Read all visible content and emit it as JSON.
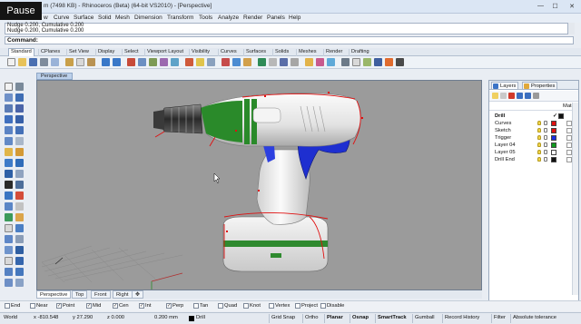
{
  "window": {
    "title": "m (7498 KB) - Rhinoceros (Beta) (64-bit VS2010) - [Perspective]",
    "pause_label": "Pause",
    "min": "—",
    "max": "☐",
    "close": "✕"
  },
  "menu": [
    "Curve",
    "Surface",
    "Solid",
    "Mesh",
    "Dimension",
    "Transform",
    "Tools",
    "Analyze",
    "Render",
    "Panels",
    "Help"
  ],
  "menu_partial": "w",
  "history": [
    "Nudge 0.200, Cumulative 0.200",
    "Nudge 0.200, Cumulative 0.200"
  ],
  "command": {
    "label": "Command:",
    "value": ""
  },
  "toolbar_tabs": [
    "Standard",
    "CPlanes",
    "Set View",
    "Display",
    "Select",
    "Viewport Layout",
    "Visibility",
    "Curves",
    "Surfaces",
    "Solids",
    "Meshes",
    "Render",
    "Drafting"
  ],
  "viewport": {
    "title": "Perspective",
    "tabs": [
      "Perspective",
      "Top",
      "Front",
      "Right"
    ],
    "add_tab": "✥"
  },
  "osnap": [
    {
      "label": "End",
      "checked": false
    },
    {
      "label": "Near",
      "checked": false
    },
    {
      "label": "Point",
      "checked": true
    },
    {
      "label": "Mid",
      "checked": true
    },
    {
      "label": "Cen",
      "checked": true
    },
    {
      "label": "Int",
      "checked": true
    },
    {
      "label": "Perp",
      "checked": true
    },
    {
      "label": "Tan",
      "checked": false
    },
    {
      "label": "Quad",
      "checked": false
    },
    {
      "label": "Knot",
      "checked": false
    },
    {
      "label": "Vertex",
      "checked": false
    },
    {
      "label": "Project",
      "checked": false
    },
    {
      "label": "Disable",
      "checked": false
    }
  ],
  "status": {
    "cplane": "World",
    "x": "x -810.548",
    "y": "y 27.290",
    "z": "z 0.000",
    "units": "0.200 mm",
    "layer": "Drill",
    "panes": [
      "Grid Snap",
      "Ortho",
      "Planar",
      "Osnap",
      "SmartTrack",
      "Gumball",
      "Record History",
      "Filter",
      "Absolute tolerance"
    ],
    "bold_panes": [
      "Planar",
      "Osnap",
      "SmartTrack"
    ]
  },
  "layers_panel": {
    "tabs": [
      "Layers",
      "Properties"
    ],
    "col_material": "Mater",
    "layers": [
      {
        "name": "Drill",
        "color": "#111111",
        "current": true
      },
      {
        "name": "Curves",
        "color": "#e01010",
        "current": false
      },
      {
        "name": "Sketch",
        "color": "#e01010",
        "current": false
      },
      {
        "name": "Trigger",
        "color": "#1a2ee0",
        "current": false
      },
      {
        "name": "Layer 04",
        "color": "#0f9a1e",
        "current": false
      },
      {
        "name": "Layer 05",
        "color": "#ffffff",
        "current": false
      },
      {
        "name": "Drill End",
        "color": "#111111",
        "current": false
      }
    ],
    "current_mark": "✓"
  }
}
